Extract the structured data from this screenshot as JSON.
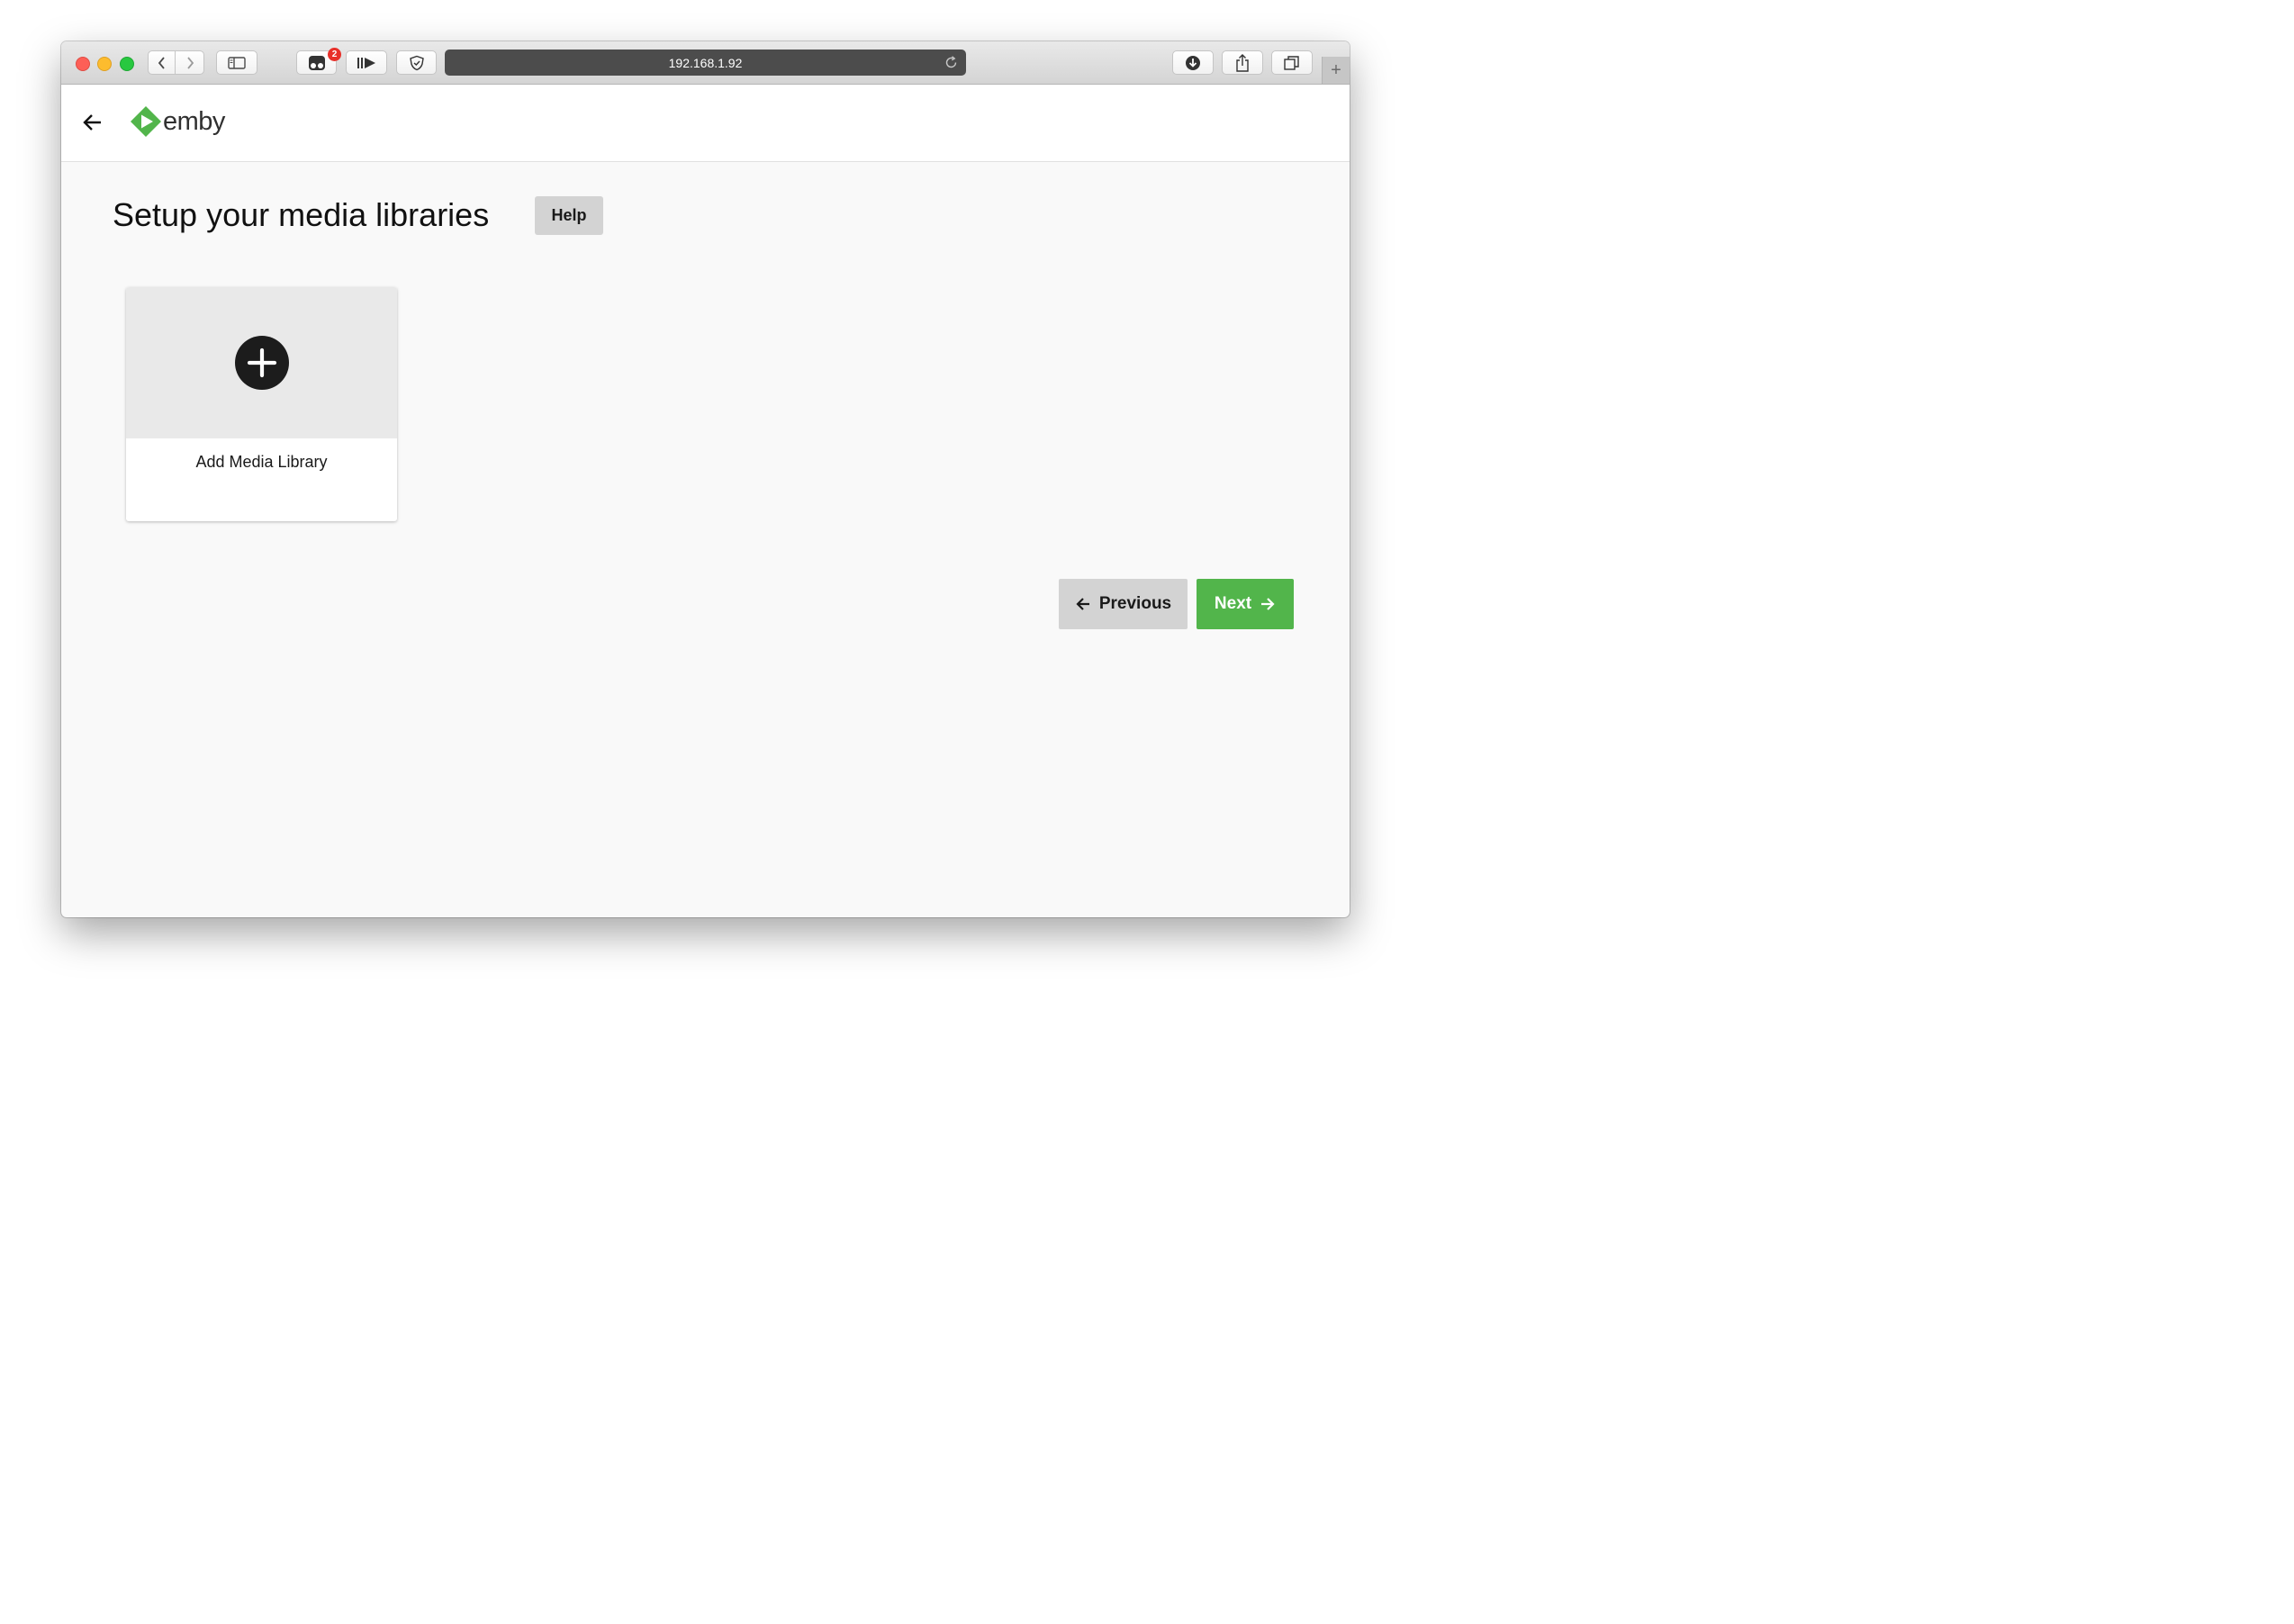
{
  "browser": {
    "url": "192.168.1.92",
    "extension_badge_count": "2"
  },
  "app": {
    "logo_text": "emby",
    "brand_color": "#52b54b"
  },
  "main": {
    "title": "Setup your media libraries",
    "help_label": "Help",
    "add_card_label": "Add Media Library"
  },
  "nav": {
    "previous_label": "Previous",
    "next_label": "Next"
  },
  "icons": {
    "back": "arrow-left-icon",
    "add": "plus-circle-icon",
    "previous": "arrow-left-icon",
    "next": "arrow-right-icon"
  }
}
